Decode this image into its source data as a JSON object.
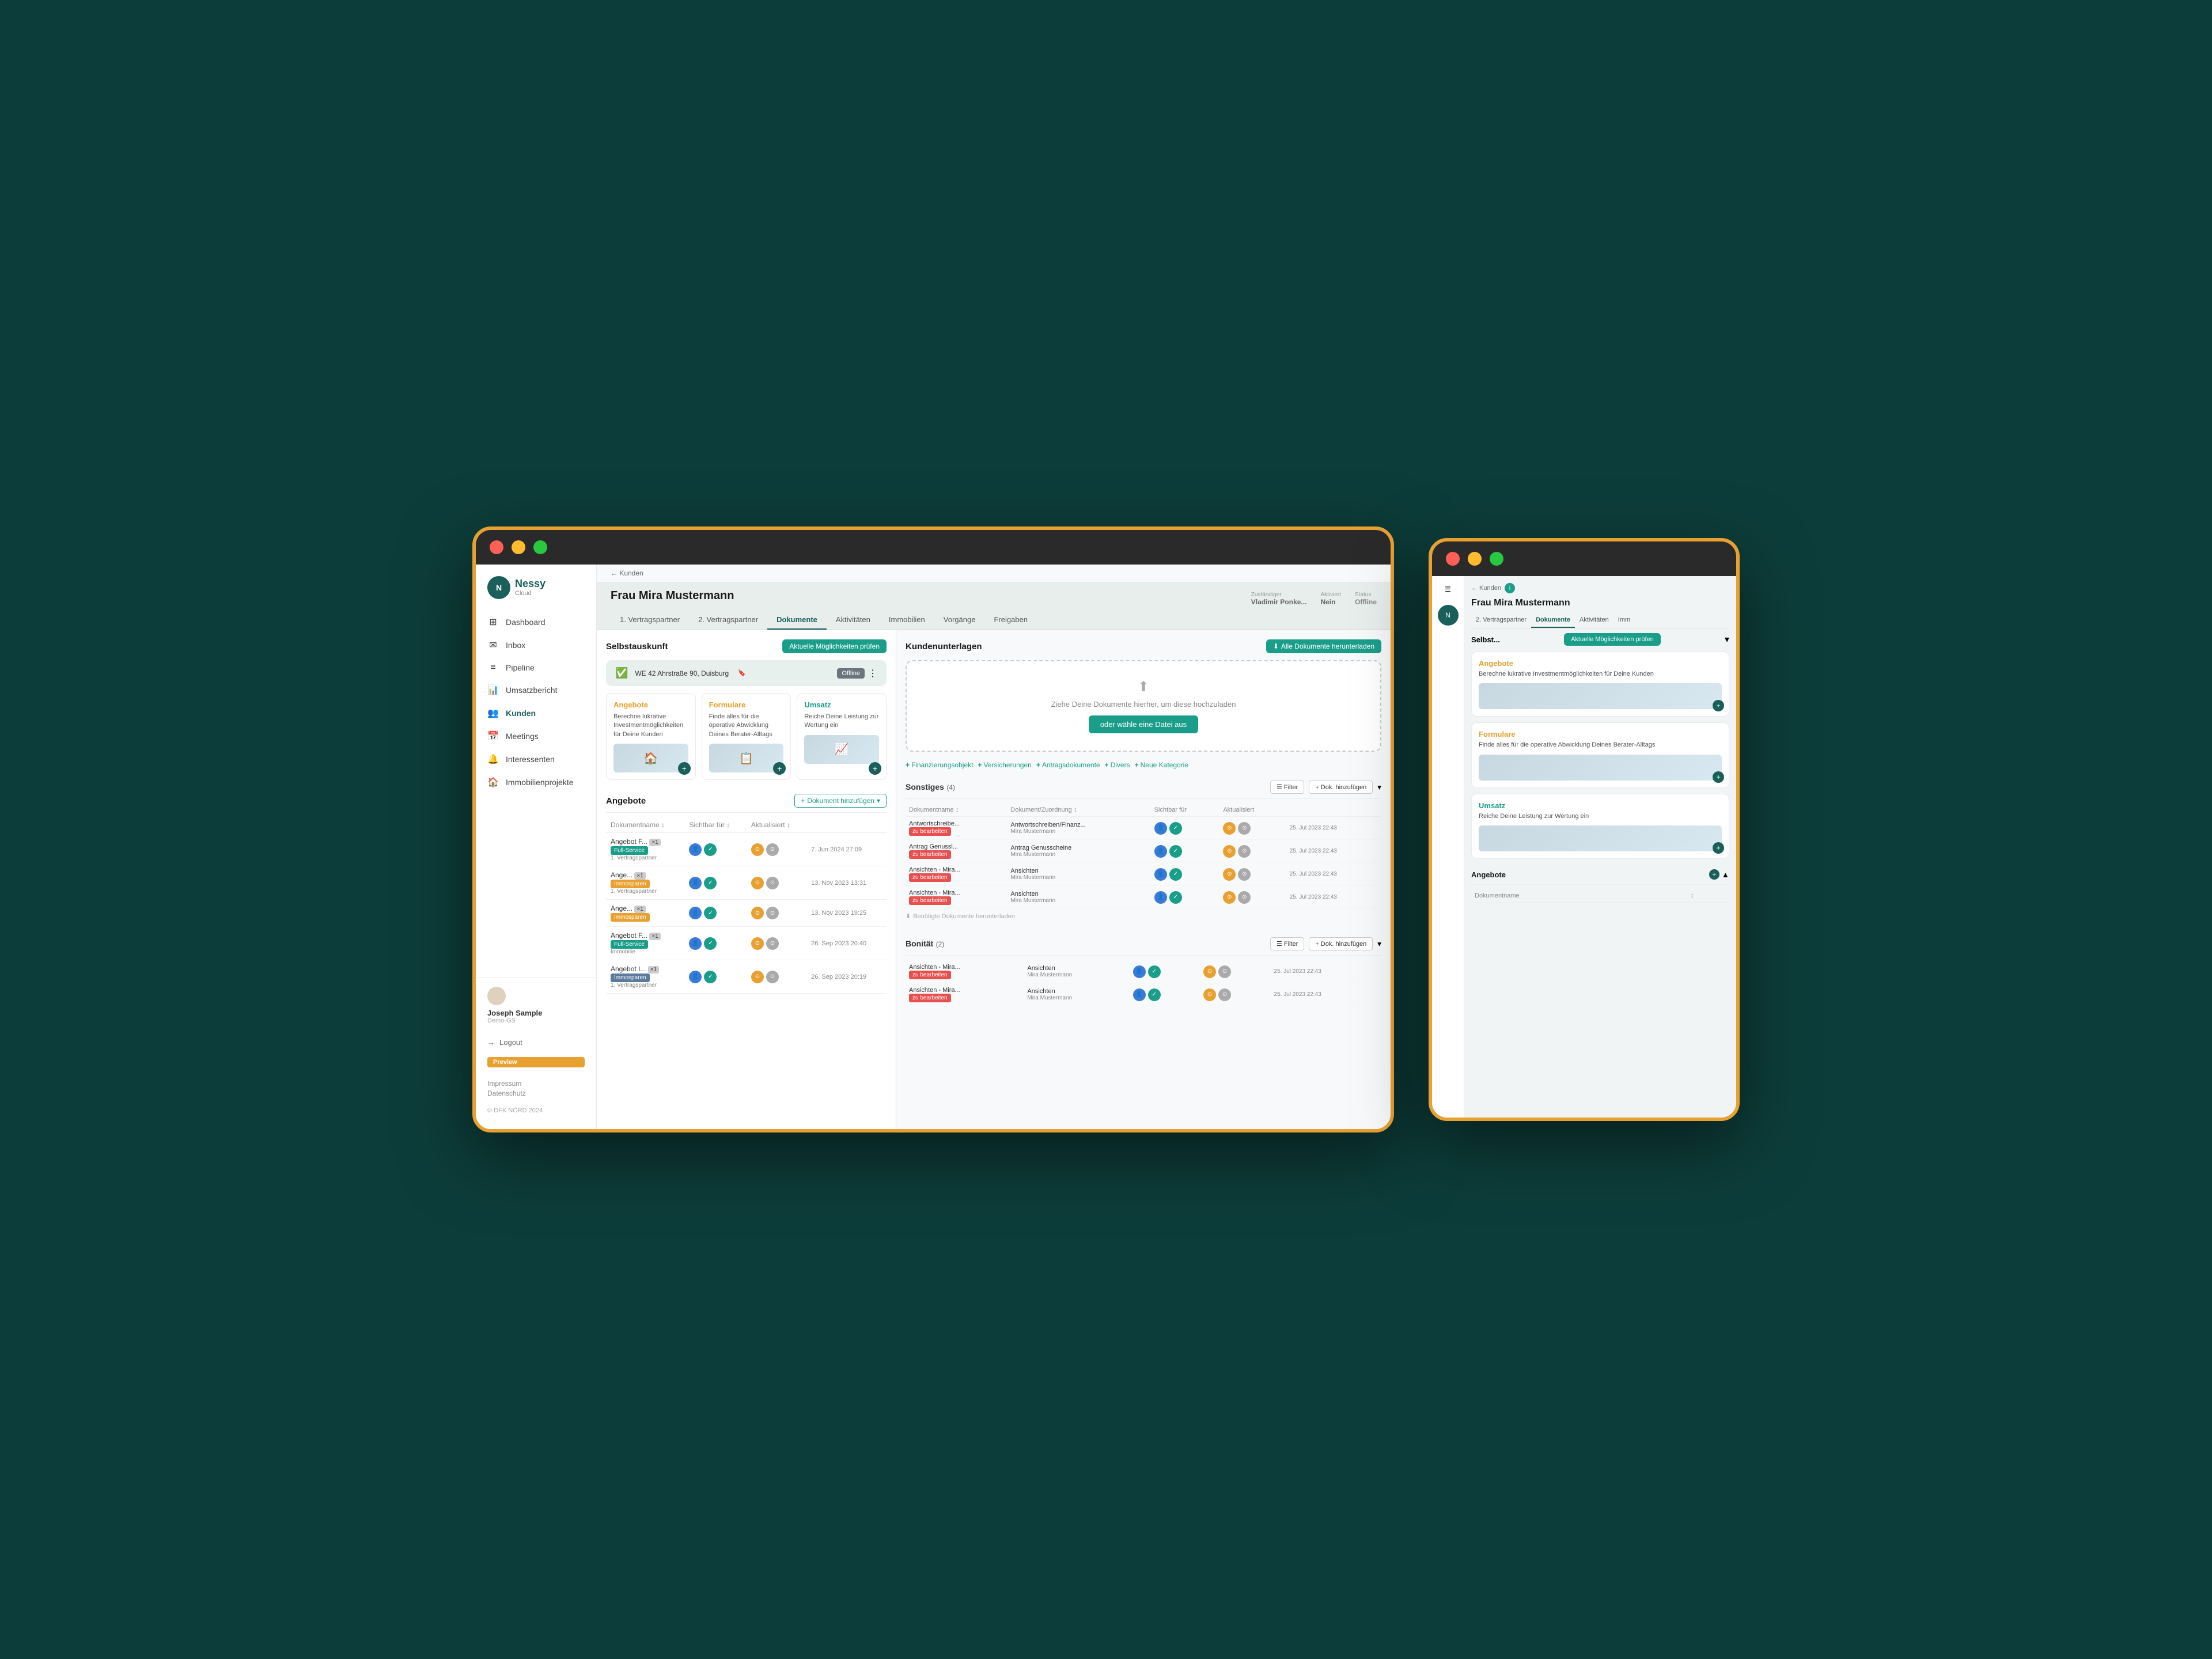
{
  "app": {
    "name": "Nessy",
    "sub": "Cloud",
    "copyright": "© DFK NORD 2024"
  },
  "sidebar": {
    "items": [
      {
        "id": "dashboard",
        "label": "Dashboard",
        "icon": "⊞"
      },
      {
        "id": "inbox",
        "label": "Inbox",
        "icon": "✉"
      },
      {
        "id": "pipeline",
        "label": "Pipeline",
        "icon": "≡"
      },
      {
        "id": "umsatzbericht",
        "label": "Umsatzbericht",
        "icon": "📊"
      },
      {
        "id": "kunden",
        "label": "Kunden",
        "icon": "👥"
      },
      {
        "id": "meetings",
        "label": "Meetings",
        "icon": "📅"
      },
      {
        "id": "interessenten",
        "label": "Interessenten",
        "icon": "🔔"
      },
      {
        "id": "immobilienprojekte",
        "label": "Immobilienprojekte",
        "icon": "🏠"
      }
    ],
    "user": "Joseph Sample",
    "demo": "Demo-GS",
    "logout": "Logout",
    "preview_label": "Preview",
    "impressum": "Impressum",
    "datenschutz": "Datenschutz"
  },
  "breadcrumb": {
    "back_label": "← Kunden",
    "back_label_side": "← Kunden"
  },
  "customer": {
    "name": "Frau Mira Mustermann",
    "meta": [
      {
        "label": "Zuständiger",
        "value": "Vladimir Ponke..."
      },
      {
        "label": "Aktiviert",
        "value": "Nein"
      },
      {
        "label": "Status",
        "value": "Offline"
      }
    ],
    "tabs": [
      "1. Vertragspartner",
      "2. Vertragspartner",
      "Dokumente",
      "Aktivitäten",
      "Immobilien",
      "Vorgänge",
      "Freigaben"
    ],
    "active_tab": "Dokumente"
  },
  "selbstauskunft": {
    "title": "Selbstauskunft",
    "btn": "Aktuelle Möglichkeiten prüfen",
    "property": "WE 42 Ahrstraße 90, Duisburg",
    "status": "Offline"
  },
  "feature_cards": [
    {
      "id": "angebote",
      "title": "Angebote",
      "desc": "Berechne lukrative Investmentmöglichkeiten für Deine Kunden",
      "color": "orange"
    },
    {
      "id": "formulare",
      "title": "Formulare",
      "desc": "Finde alles für die operative Abwicklung Deines Berater-Alltags",
      "color": "orange"
    },
    {
      "id": "umsatz",
      "title": "Umsatz",
      "desc": "Reiche Deine Leistung zur Wertung ein",
      "color": "teal"
    }
  ],
  "angebote_section": {
    "title": "Angebote",
    "add_btn": "Dokument hinzufügen",
    "columns": [
      "Dokumentname",
      "Sichtbar für",
      "Aktualisiert"
    ],
    "rows": [
      {
        "name": "Angebot F...",
        "tag": "×1",
        "tag_type": "Full-Service",
        "tag_color": "full",
        "sub": "1. Vertragspartner",
        "date": "7. Jun 2024 27:09"
      },
      {
        "name": "Ange...",
        "tag": "×1",
        "tag_type": "Immosparen",
        "tag_color": "immo",
        "sub": "1. Vertragspartner",
        "date": "13. Nov 2023 13:31"
      },
      {
        "name": "Ange...",
        "tag": "×1",
        "tag_type": "Immosparen",
        "tag_color": "immo",
        "sub": "",
        "date": "13. Nov 2023 19:25"
      },
      {
        "name": "Angebot F...",
        "tag": "×1",
        "tag_type": "Full-Service",
        "tag_color": "full",
        "sub": "Immobilie",
        "date": "26. Sep 2023 20:40"
      },
      {
        "name": "Angebot I...",
        "tag": "×1",
        "tag_type": "",
        "tag_color": "spar",
        "sub": "1. Vertragspartner",
        "date": "26. Sep 2023 20:19"
      }
    ]
  },
  "kundenunterlagen": {
    "title": "Kundenunterlagen",
    "download_btn": "Alle Dokumente herunterladen",
    "upload": {
      "drag_text": "Ziehe Deine Dokumente hierher, um diese hochzuladen",
      "or_text": "oder wähle eine Datei aus"
    },
    "filter_tabs": [
      "Finanzierungsobjekt",
      "Versicherungen",
      "Antragsdokumente",
      "Divers",
      "Neue Kategorie"
    ],
    "categories": [
      {
        "title": "Sonstiges",
        "count": 4,
        "columns": [
          "Dokumentname",
          "Dokument/Zuordnung",
          "Sichtbar für",
          "Aktualisiert"
        ],
        "rows": [
          {
            "name": "Antwortschreibe...",
            "zuordnung": "Antwortschreiben/Finanz...",
            "status": "zu bearbeiten",
            "status_color": "red",
            "author": "Mira Mustermann",
            "date": "25. Jul 2023 22:43"
          },
          {
            "name": "Antrag Genussl...",
            "zuordnung": "Antrag Genusscheine",
            "status": "zu bearbeiten",
            "status_color": "red",
            "author": "Mira Mustermann",
            "date": "25. Jul 2023 22:43"
          },
          {
            "name": "Ansichten - Mira...",
            "zuordnung": "Ansichten",
            "status": "zu bearbeiten",
            "status_color": "red",
            "author": "Mira Mustermann",
            "date": "25. Jul 2023 22:43"
          },
          {
            "name": "Ansichten - Mira...",
            "zuordnung": "Ansichten",
            "status": "zu bearbeiten",
            "status_color": "red",
            "author": "Mira Mustermann",
            "date": "25. Jul 2023 22:43"
          }
        ]
      },
      {
        "title": "Bonität",
        "count": 2,
        "rows": [
          {
            "name": "Ansichten - Mira...",
            "zuordnung": "Ansichten",
            "status": "zu bearbeiten",
            "status_color": "red",
            "author": "Mira Mustermann",
            "date": "25. Jul 2023 22:43"
          },
          {
            "name": "Ansichten - Mira...",
            "zuordnung": "Ansichten",
            "status": "zu bearbeiten",
            "status_color": "red",
            "author": "Mira Mustermann",
            "date": "25. Jul 2023 22:43"
          }
        ]
      }
    ]
  },
  "side_panel": {
    "customer_name": "Frau Mira Mustermann",
    "tabs": [
      "2. Vertragspartner",
      "Dokumente",
      "Aktivitäten",
      "Imm"
    ],
    "active_tab": "Dokumente",
    "selbst_title": "Selbst...",
    "moeglichkeiten_btn": "Aktuelle Möglichkeiten prüfen",
    "feature_cards": [
      {
        "title": "Angebote",
        "desc": "Berechne lukrative Investmentmöglichkeiten für Deine Kunden",
        "color": "orange"
      },
      {
        "title": "Formulare",
        "desc": "Finde alles für die operative Abwicklung Deines Berater-Alltags",
        "color": "orange"
      },
      {
        "title": "Umsatz",
        "desc": "Reiche Deine Leistung zur Wertung ein",
        "color": "teal"
      }
    ],
    "angebote_section": {
      "title": "Angebote",
      "col": "Dokumentname"
    }
  },
  "colors": {
    "primary": "#1a5f5a",
    "accent": "#e8a030",
    "teal": "#1a9e8a",
    "bg": "#0d3d3a",
    "red": "#e85050"
  }
}
